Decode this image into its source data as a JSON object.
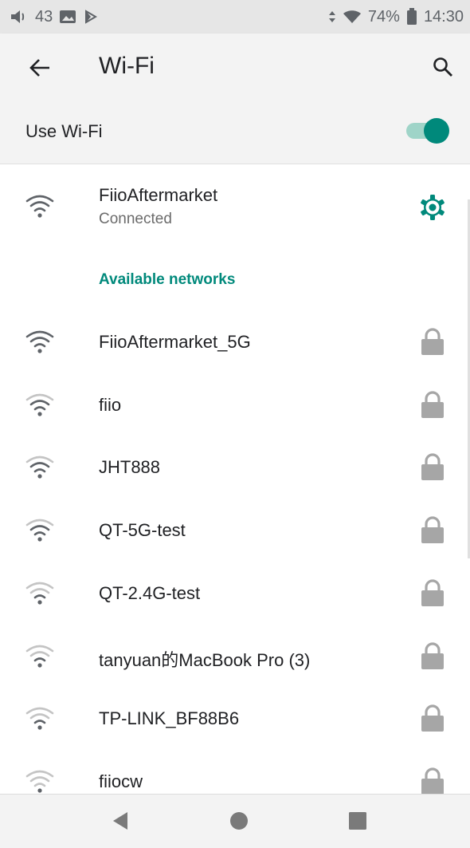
{
  "status_bar": {
    "volume_level": "43",
    "battery_percent": "74%",
    "time": "14:30"
  },
  "app_bar": {
    "title": "Wi-Fi",
    "back_icon": "arrow-back-icon",
    "search_icon": "search-icon"
  },
  "use_wifi": {
    "label": "Use Wi-Fi",
    "enabled": true
  },
  "connected": {
    "ssid": "FiioAftermarket",
    "status": "Connected",
    "settings_icon": "gear-icon"
  },
  "available_header": "Available networks",
  "networks": [
    {
      "ssid": "FiioAftermarket_5G",
      "signal": 4,
      "secured": true
    },
    {
      "ssid": "fiio",
      "signal": 3,
      "secured": true
    },
    {
      "ssid": "JHT888",
      "signal": 3,
      "secured": true
    },
    {
      "ssid": "QT-5G-test",
      "signal": 3,
      "secured": true
    },
    {
      "ssid": "QT-2.4G-test",
      "signal": 2,
      "secured": true
    },
    {
      "ssid": "tanyuan的MacBook Pro (3)",
      "signal": 2,
      "secured": true
    },
    {
      "ssid": "TP-LINK_BF88B6",
      "signal": 2,
      "secured": true
    },
    {
      "ssid": "fiiocw",
      "signal": 1,
      "secured": true
    }
  ],
  "nav_bar": {
    "back": "nav-back-icon",
    "home": "nav-home-icon",
    "recents": "nav-recents-icon"
  },
  "colors": {
    "accent": "#00897b",
    "icon_strong": "#5f6368",
    "icon_faint": "#c4c4c4",
    "lock": "#a6a6a6"
  }
}
